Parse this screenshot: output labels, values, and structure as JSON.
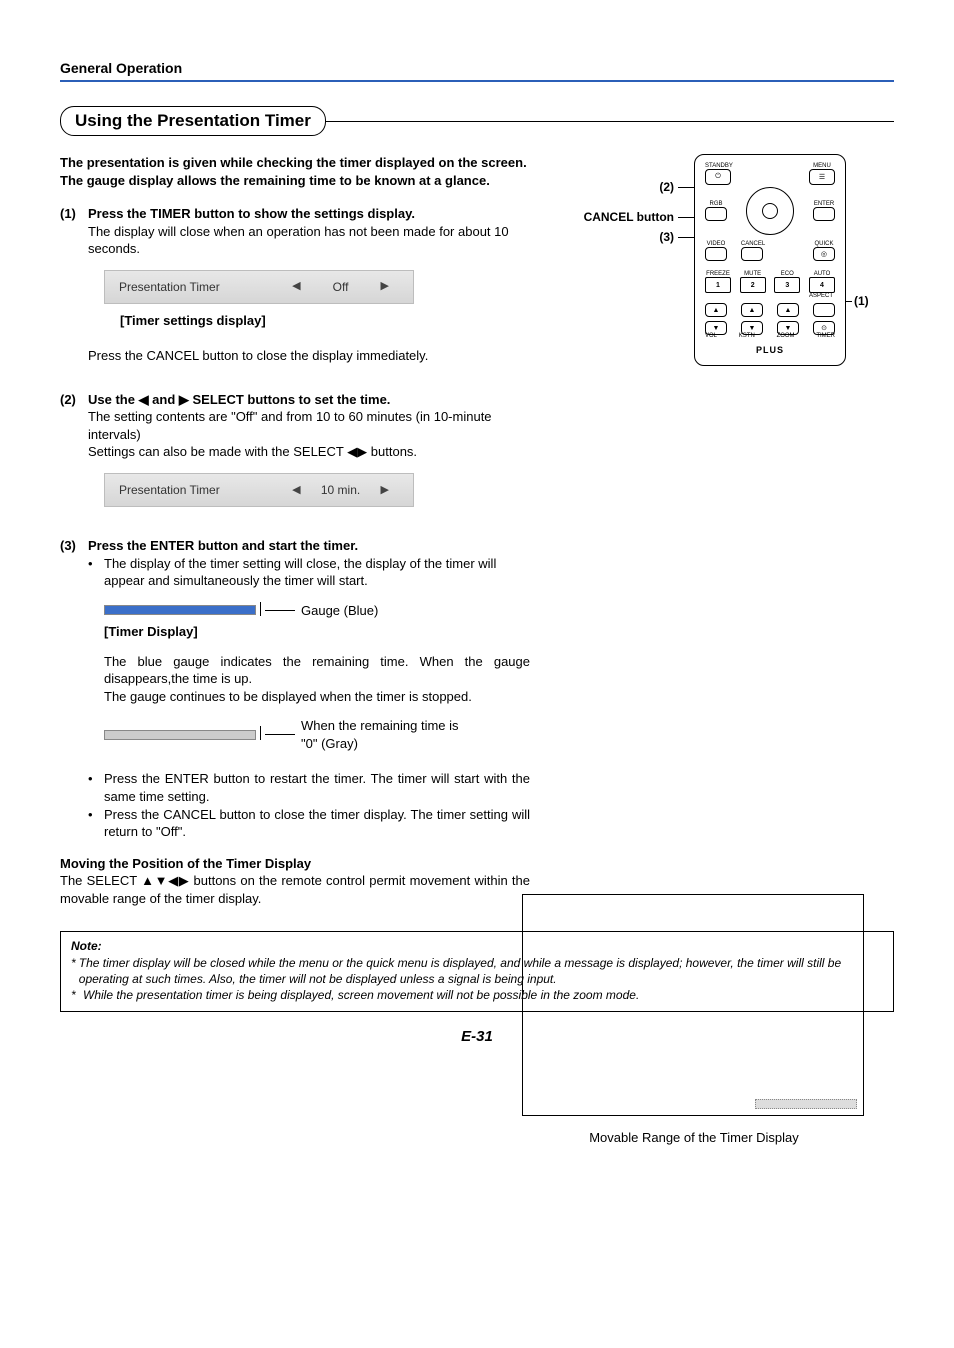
{
  "header": {
    "section": "General Operation"
  },
  "title": "Using the Presentation Timer",
  "intro": "The presentation is given while checking the timer displayed on the screen.\nThe gauge display allows the remaining time to be known at a glance.",
  "steps": {
    "s1": {
      "num": "(1)",
      "title": "Press the TIMER button to show the settings display.",
      "body": "The display will close when an operation has not been made for about 10 seconds.",
      "osd_label": "Presentation Timer",
      "osd_value": "Off",
      "caption": "[Timer settings display]",
      "after": "Press the CANCEL button to close the display immediately."
    },
    "s2": {
      "num": "(2)",
      "title": "Use the ◀ and ▶ SELECT buttons to set the time.",
      "body1": "The setting contents are \"Off\" and from 10 to 60 minutes (in 10-minute intervals)",
      "body2": "Settings can also be made with the SELECT ◀▶ buttons.",
      "osd_label": "Presentation Timer",
      "osd_value": "10 min."
    },
    "s3": {
      "num": "(3)",
      "title": "Press the ENTER button and start the timer.",
      "bullet1": "The display of the timer setting will close, the display of the timer will appear and simultaneously the timer will start.",
      "gauge_label": "Gauge (Blue)",
      "disp_caption": "[Timer Display]",
      "para1": "The blue gauge indicates the remaining time. When the gauge disappears,the time is up.",
      "para2": "The gauge continues to be displayed when the timer is stopped.",
      "gray_label1": "When the remaining time is",
      "gray_label2": "\"0\" (Gray)",
      "bullet2": "Press the ENTER button to restart the timer. The timer will start with the same time setting.",
      "bullet3": "Press the CANCEL button to close the timer display. The timer setting will return to \"Off\"."
    }
  },
  "moving": {
    "head": "Moving the Position of the Timer Display",
    "body": "The SELECT ▲▼◀▶ buttons on the remote control permit movement within the movable range of the timer display."
  },
  "remote_labels": {
    "l2": "(2)",
    "cancel": "CANCEL button",
    "l3": "(3)",
    "l1": "(1)",
    "btns": {
      "standby": "STANDBY",
      "menu": "MENU",
      "rgb": "RGB",
      "enter": "ENTER",
      "video": "VIDEO",
      "cancel": "CANCEL",
      "quick": "QUICK",
      "freeze": "FREEZE",
      "mute": "MUTE",
      "eco": "ECO",
      "auto": "AUTO",
      "aspect": "ASPECT",
      "n1": "1",
      "n2": "2",
      "n3": "3",
      "n4": "4",
      "vol": "VOL",
      "kstn": "KSTN",
      "zoom": "ZOOM",
      "timer": "TIMER"
    },
    "plus": "PLUS"
  },
  "movable_caption": "Movable Range of the Timer Display",
  "note": {
    "title": "Note:",
    "n1": "The timer display will be closed while the menu or the quick menu is displayed, and while a message is displayed; however, the timer will still be operating at such times. Also, the timer will not be displayed unless a signal is being input.",
    "n2": "While the presentation timer is being displayed, screen movement will not be possible in the zoom mode."
  },
  "page_num": "E-31"
}
